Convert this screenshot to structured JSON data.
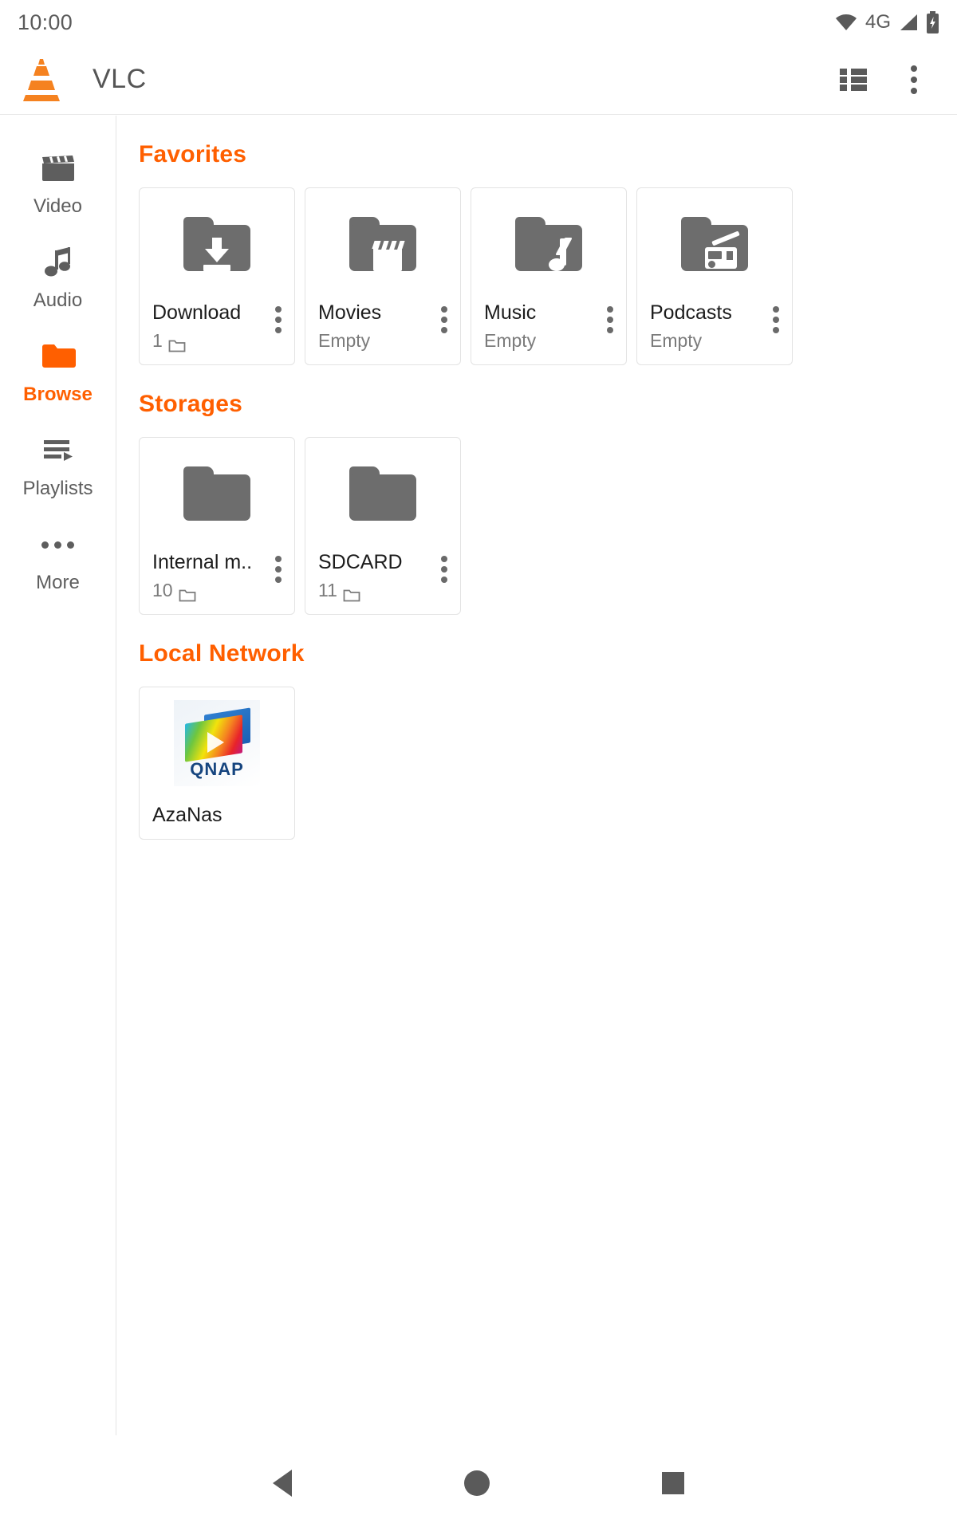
{
  "status_bar": {
    "time": "10:00",
    "network_type": "4G",
    "icons": [
      "wifi-icon",
      "signal-icon",
      "battery-charging-icon"
    ]
  },
  "app_bar": {
    "title": "VLC",
    "logo": "vlc-cone-logo",
    "actions": [
      {
        "name": "list-view-toggle",
        "icon": "list-view-icon"
      },
      {
        "name": "overflow-menu",
        "icon": "kebab-menu-icon"
      }
    ]
  },
  "sidebar": {
    "items": [
      {
        "label": "Video",
        "icon": "video-clapperboard-icon",
        "active": false
      },
      {
        "label": "Audio",
        "icon": "music-note-icon",
        "active": false
      },
      {
        "label": "Browse",
        "icon": "folder-icon",
        "active": true
      },
      {
        "label": "Playlists",
        "icon": "playlist-icon",
        "active": false
      },
      {
        "label": "More",
        "icon": "more-horizontal-icon",
        "active": false
      }
    ],
    "active_color": "#ff5f00",
    "inactive_color": "#5e5e5e"
  },
  "content": {
    "accent_color": "#ff5f00",
    "sections": [
      {
        "title": "Favorites",
        "cards": [
          {
            "title": "Download",
            "subtitle": "1",
            "subtitle_icon": "folder-outline-icon",
            "art": "folder-download-icon"
          },
          {
            "title": "Movies",
            "subtitle": "Empty",
            "subtitle_icon": "",
            "art": "folder-movie-icon"
          },
          {
            "title": "Music",
            "subtitle": "Empty",
            "subtitle_icon": "",
            "art": "folder-music-icon"
          },
          {
            "title": "Podcasts",
            "subtitle": "Empty",
            "subtitle_icon": "",
            "art": "folder-podcast-icon"
          }
        ]
      },
      {
        "title": "Storages",
        "cards": [
          {
            "title": "Internal m..",
            "subtitle": "10",
            "subtitle_icon": "folder-outline-icon",
            "art": "folder-plain-icon"
          },
          {
            "title": "SDCARD",
            "subtitle": "11",
            "subtitle_icon": "folder-outline-icon",
            "art": "folder-plain-icon"
          }
        ]
      },
      {
        "title": "Local Network",
        "cards": [
          {
            "title": "AzaNas",
            "subtitle": "",
            "subtitle_icon": "",
            "art": "qnap-logo",
            "art_text": "QNAP"
          }
        ]
      }
    ]
  },
  "nav_bar": {
    "buttons": [
      {
        "name": "back-button",
        "icon": "triangle-back-icon"
      },
      {
        "name": "home-button",
        "icon": "circle-home-icon"
      },
      {
        "name": "recents-button",
        "icon": "square-recents-icon"
      }
    ]
  }
}
